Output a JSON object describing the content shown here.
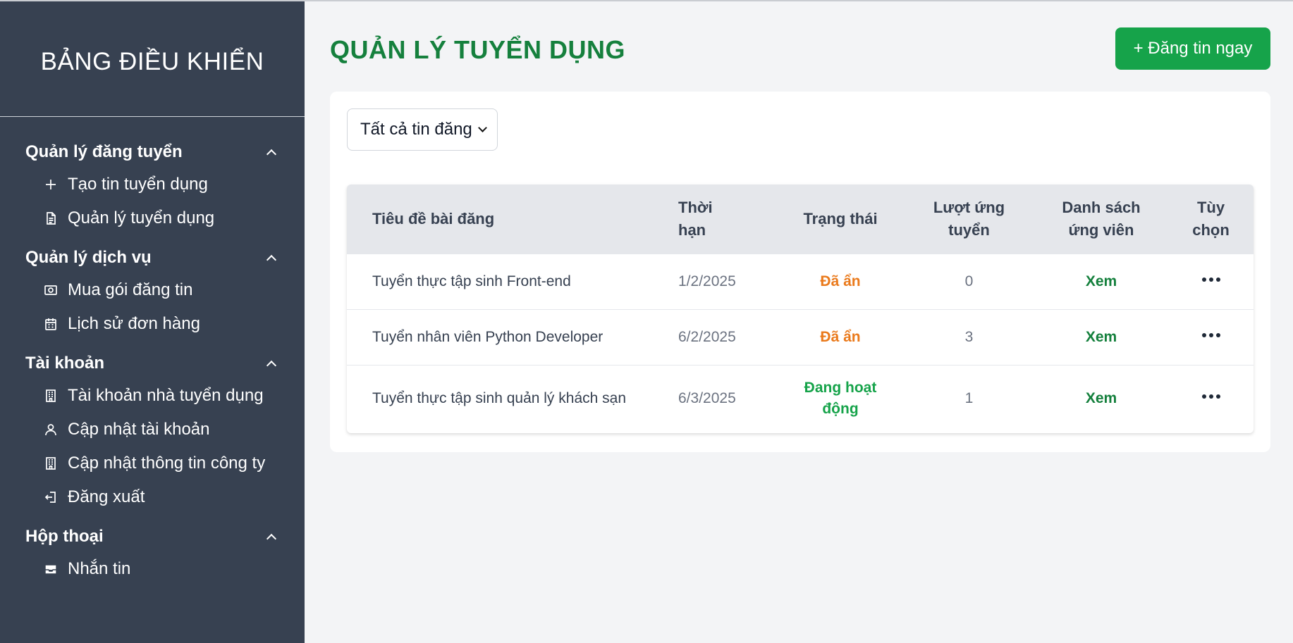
{
  "sidebar": {
    "title": "BẢNG ĐIỀU KHIỂN",
    "groups": [
      {
        "label": "Quản lý đăng tuyển",
        "items": [
          {
            "label": "Tạo tin tuyển dụng",
            "icon": "plus-icon"
          },
          {
            "label": "Quản lý tuyển dụng",
            "icon": "document-icon"
          }
        ]
      },
      {
        "label": "Quản lý dịch vụ",
        "items": [
          {
            "label": "Mua gói đăng tin",
            "icon": "cash-icon"
          },
          {
            "label": "Lịch sử đơn hàng",
            "icon": "calendar-icon"
          }
        ]
      },
      {
        "label": "Tài khoản",
        "items": [
          {
            "label": "Tài khoản nhà tuyển dụng",
            "icon": "building-icon"
          },
          {
            "label": "Cập nhật tài khoản",
            "icon": "user-icon"
          },
          {
            "label": "Cập nhật thông tin công ty",
            "icon": "building-icon"
          },
          {
            "label": "Đăng xuất",
            "icon": "logout-icon"
          }
        ]
      },
      {
        "label": "Hộp thoại",
        "items": [
          {
            "label": "Nhắn tin",
            "icon": "inbox-icon"
          }
        ]
      }
    ]
  },
  "main": {
    "title": "QUẢN LÝ TUYỂN DỤNG",
    "post_button": "+ Đăng tin ngay",
    "filter": {
      "selected": "Tất cả tin đăng"
    },
    "table": {
      "headers": {
        "title": "Tiêu đề bài đăng",
        "deadline_1": "Thời",
        "deadline_2": "hạn",
        "status": "Trạng thái",
        "apply_1": "Lượt ứng",
        "apply_2": "tuyển",
        "list_1": "Danh sách",
        "list_2": "ứng viên",
        "options_1": "Tùy",
        "options_2": "chọn"
      },
      "rows": [
        {
          "title": "Tuyển thực tập sinh Front-end",
          "deadline": "1/2/2025",
          "status": "Đã ẩn",
          "applications": "0",
          "view": "Xem"
        },
        {
          "title": "Tuyển nhân viên Python Developer",
          "deadline": "6/2/2025",
          "status": "Đã ẩn",
          "applications": "3",
          "view": "Xem"
        },
        {
          "title": "Tuyển thực tập sinh quản lý khách sạn",
          "deadline": "6/3/2025",
          "status_1": "Đang hoạt",
          "status_2": "động",
          "applications": "1",
          "view": "Xem"
        }
      ]
    }
  },
  "colors": {
    "sidebar_bg": "#374151",
    "accent_green": "#15803d",
    "button_green": "#16a34a",
    "status_hidden": "#ea7a1c",
    "page_bg": "#f3f4f6"
  }
}
